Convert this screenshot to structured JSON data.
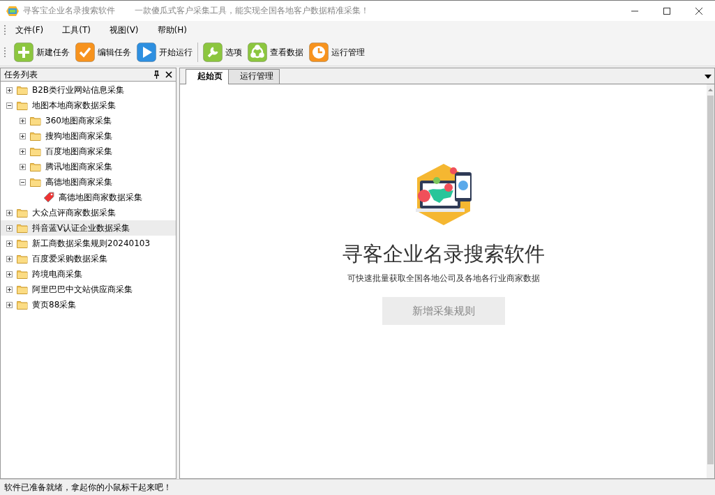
{
  "window": {
    "title": "寻客宝企业名录搜索软件",
    "subtitle": "一款傻瓜式客户采集工具，能实现全国各地客户数据精准采集！"
  },
  "menu": [
    "文件(F)",
    "工具(T)",
    "视图(V)",
    "帮助(H)"
  ],
  "toolbar": [
    {
      "label": "新建任务",
      "kind": "plus",
      "color": "#8cc63f"
    },
    {
      "label": "编辑任务",
      "kind": "check",
      "color": "#f7931e"
    },
    {
      "label": "开始运行",
      "kind": "play",
      "color": "#2d8fe0"
    },
    {
      "label": "选项",
      "kind": "wrench",
      "color": "#8cc63f"
    },
    {
      "label": "查看数据",
      "kind": "share",
      "color": "#8cc63f"
    },
    {
      "label": "运行管理",
      "kind": "clock",
      "color": "#f7931e"
    }
  ],
  "task_panel": {
    "title": "任务列表",
    "tree": [
      {
        "label": "B2B类行业网站信息采集",
        "kind": "folder",
        "expanded": false,
        "selected": false
      },
      {
        "label": "地图本地商家数据采集",
        "kind": "folder",
        "expanded": true,
        "selected": false,
        "children": [
          {
            "label": "360地图商家采集",
            "kind": "folder",
            "expanded": false,
            "selected": false
          },
          {
            "label": "搜狗地图商家采集",
            "kind": "folder",
            "expanded": false,
            "selected": false
          },
          {
            "label": "百度地图商家采集",
            "kind": "folder",
            "expanded": false,
            "selected": false
          },
          {
            "label": "腾讯地图商家采集",
            "kind": "folder",
            "expanded": false,
            "selected": false
          },
          {
            "label": "高德地图商家采集",
            "kind": "folder",
            "expanded": true,
            "selected": false,
            "children": [
              {
                "label": "高德地图商家数据采集",
                "kind": "rule",
                "selected": false
              }
            ]
          }
        ]
      },
      {
        "label": "大众点评商家数据采集",
        "kind": "folder",
        "expanded": false,
        "selected": false
      },
      {
        "label": "抖音蓝V认证企业数据采集",
        "kind": "folder",
        "expanded": false,
        "selected": true
      },
      {
        "label": "新工商数据采集规则20240103",
        "kind": "folder",
        "expanded": false,
        "selected": false
      },
      {
        "label": "百度爱采购数据采集",
        "kind": "folder",
        "expanded": false,
        "selected": false
      },
      {
        "label": "跨境电商采集",
        "kind": "folder",
        "expanded": false,
        "selected": false
      },
      {
        "label": "阿里巴巴中文站供应商采集",
        "kind": "folder",
        "expanded": false,
        "selected": false
      },
      {
        "label": "黄页88采集",
        "kind": "folder",
        "expanded": false,
        "selected": false
      }
    ]
  },
  "tabs": [
    {
      "label": "起始页",
      "selected": true
    },
    {
      "label": "运行管理",
      "selected": false
    }
  ],
  "start_page": {
    "heading": "寻客企业名录搜索软件",
    "description": "可快速批量获取全国各地公司及各地各行业商家数据",
    "button": "新增采集规则"
  },
  "status_bar": "软件已准备就绪，拿起你的小鼠标干起来吧！"
}
